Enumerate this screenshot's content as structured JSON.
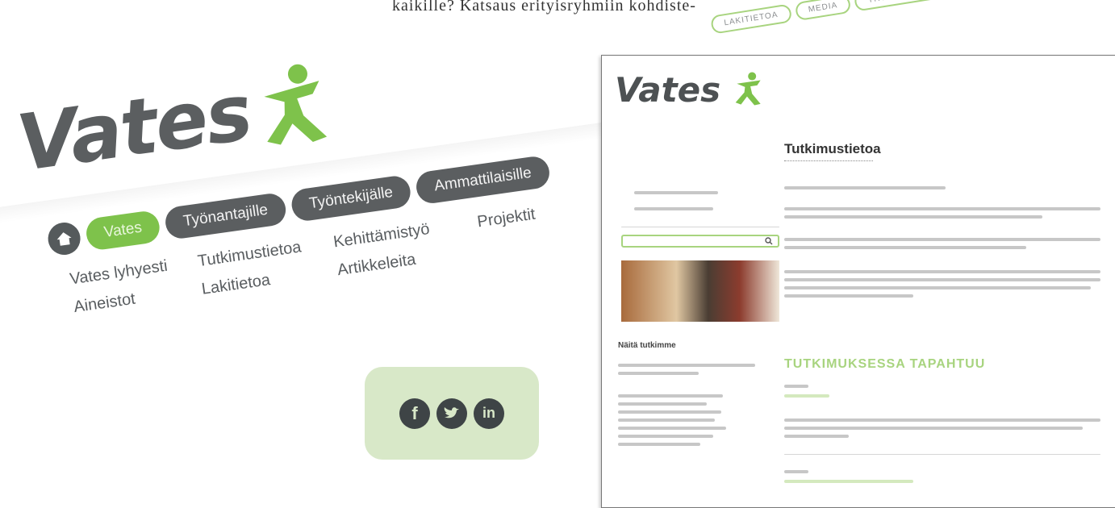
{
  "doc_text": "kaikille? Katsaus erityisryhmiin kohdiste-",
  "nav": {
    "logo": "Vates",
    "pills": [
      {
        "label": "Vates",
        "active": true
      },
      {
        "label": "Työnantajille",
        "active": false
      },
      {
        "label": "Työntekijälle",
        "active": false
      },
      {
        "label": "Ammattilaisille",
        "active": false
      }
    ],
    "sublinks": [
      "Vates lyhyesti",
      "Tutkimustietoa",
      "Kehittämistyö",
      "Projektit",
      "Aineistot",
      "Lakitietoa",
      "Artikkeleita"
    ]
  },
  "social": {
    "icons": [
      "facebook-icon",
      "twitter-icon",
      "linkedin-icon"
    ]
  },
  "page": {
    "tabs": [
      "LAKITIETOA",
      "MEDIA",
      "YHTEYSTIEDOT"
    ],
    "logo": "Vates",
    "title": "Tutkimustietoa",
    "green_heading": "TUTKIMUKSESSA TAPAHTUU",
    "section_title": "Näitä tutkimme"
  },
  "colors": {
    "brand_green": "#7ec24b",
    "brand_gray": "#5b5e60",
    "social_bg": "#d8e8c8"
  }
}
